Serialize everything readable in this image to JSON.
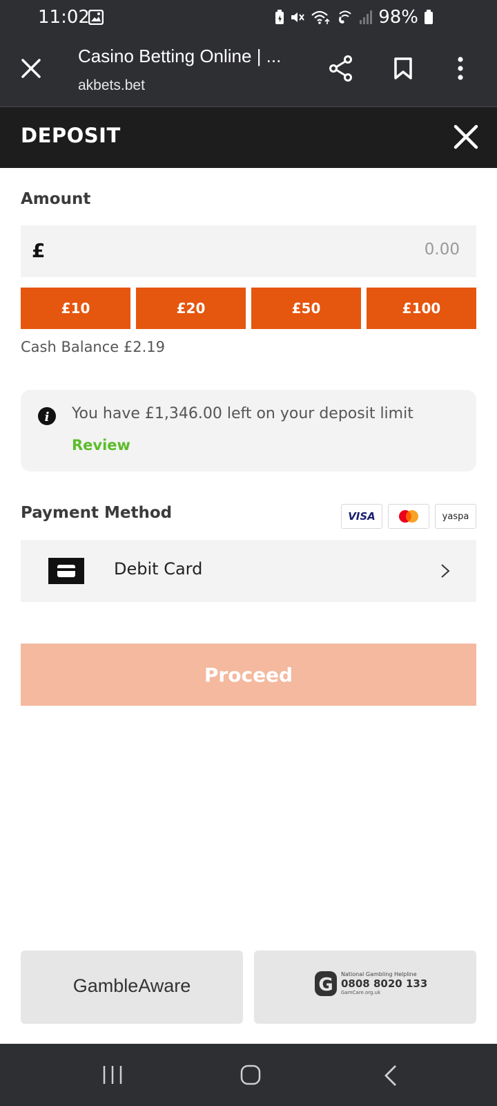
{
  "status_bar": {
    "time": "11:02",
    "battery": "98%",
    "icons": [
      "gallery-icon",
      "battery-saver-icon",
      "mute-icon",
      "wifi-icon",
      "wifi-calling-icon",
      "signal-icon",
      "battery-icon"
    ]
  },
  "browser": {
    "title": "Casino Betting Online | ...",
    "url": "akbets.bet",
    "icons": [
      "close-icon",
      "share-icon",
      "bookmark-icon",
      "more-vertical-icon"
    ]
  },
  "deposit": {
    "title": "DEPOSIT",
    "amount_label": "Amount",
    "currency_symbol": "£",
    "amount_value": "0.00",
    "quick_amounts": [
      "£10",
      "£20",
      "£50",
      "£100"
    ],
    "cash_balance_label": "Cash Balance",
    "cash_balance_value": "£2.19",
    "limit_message": "You have £1,346.00 left on your deposit limit",
    "review_label": "Review",
    "payment_method_label": "Payment Method",
    "payment_logos": {
      "visa": "VISA",
      "yaspa": "yaspa"
    },
    "debit_card_label": "Debit Card",
    "proceed_label": "Proceed"
  },
  "footer": {
    "gambleaware": "GambleAware",
    "helpline_title": "National Gambling Helpline",
    "helpline_phone": "0808 8020 133",
    "helpline_site": "GamCare.org.uk",
    "helpline_logo_letter": "G"
  },
  "colors": {
    "accent": "#e5560f",
    "proceed_disabled": "#f4b99f",
    "review_green": "#5bbd2a",
    "header_dark": "#1d1d1d",
    "browser_bar": "#2e2f33"
  }
}
